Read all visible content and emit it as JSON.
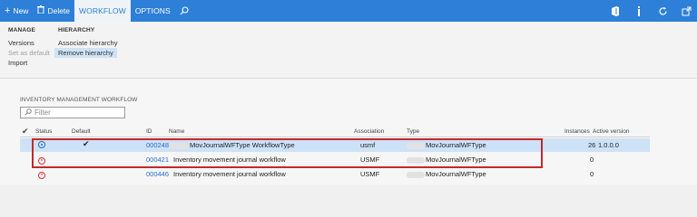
{
  "toolbar": {
    "new_label": "New",
    "delete_label": "Delete",
    "tabs": [
      "WORKFLOW",
      "OPTIONS"
    ]
  },
  "ribbon": {
    "manage": {
      "title": "MANAGE",
      "items": [
        "Versions",
        "Set as default",
        "Import"
      ]
    },
    "hierarchy": {
      "title": "HIERARCHY",
      "items": [
        "Associate hierarchy",
        "Remove hierarchy"
      ]
    }
  },
  "content": {
    "section_title": "INVENTORY MANAGEMENT WORKFLOW",
    "filter_placeholder": "Filter",
    "columns": [
      "Status",
      "Default",
      "ID",
      "Name",
      "Association",
      "Type",
      "Instances",
      "Active version"
    ],
    "rows": [
      {
        "default": "✔",
        "id": "000248",
        "name": "MovJournalWFType WorkflowType",
        "association": "usmf",
        "type": "MovJournalWFType",
        "instances": "26",
        "active_version": "1.0.0.0"
      },
      {
        "default": "",
        "id": "000421",
        "name": "Inventory movement journal workflow",
        "association": "USMF",
        "type": "MovJournalWFType",
        "instances": "0",
        "active_version": ""
      },
      {
        "default": "",
        "id": "000446",
        "name": "Inventory movement journal workflow",
        "association": "USMF",
        "type": "MovJournalWFType",
        "instances": "0",
        "active_version": ""
      }
    ]
  },
  "colors": {
    "command_bar": "#2d7fd8",
    "selected_row": "#cde1f7",
    "highlight_box": "#c22a2a",
    "link": "#2b6fc6"
  }
}
